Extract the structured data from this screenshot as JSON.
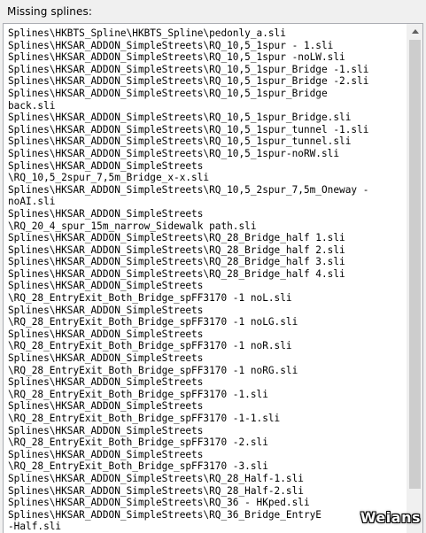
{
  "caption": "Missing splines:",
  "lines": [
    "Splines\\HKBTS_Spline\\HKBTS_Spline\\pedonly_a.sli",
    "Splines\\HKSAR_ADDON_SimpleStreets\\RQ_10,5_1spur - 1.sli",
    "Splines\\HKSAR_ADDON_SimpleStreets\\RQ_10,5_1spur -noLW.sli",
    "Splines\\HKSAR_ADDON_SimpleStreets\\RQ_10,5_1spur_Bridge -1.sli",
    "Splines\\HKSAR_ADDON_SimpleStreets\\RQ_10,5_1spur_Bridge -2.sli",
    "Splines\\HKSAR_ADDON_SimpleStreets\\RQ_10,5_1spur_Bridge",
    "back.sli",
    "Splines\\HKSAR_ADDON_SimpleStreets\\RQ_10,5_1spur_Bridge.sli",
    "Splines\\HKSAR_ADDON_SimpleStreets\\RQ_10,5_1spur_tunnel -1.sli",
    "Splines\\HKSAR_ADDON_SimpleStreets\\RQ_10,5_1spur_tunnel.sli",
    "Splines\\HKSAR_ADDON_SimpleStreets\\RQ_10,5_1spur-noRW.sli",
    "Splines\\HKSAR_ADDON_SimpleStreets",
    "\\RQ_10,5_2spur_7,5m_Bridge_x-x.sli",
    "Splines\\HKSAR_ADDON_SimpleStreets\\RQ_10,5_2spur_7,5m_Oneway -",
    "noAI.sli",
    "Splines\\HKSAR_ADDON_SimpleStreets",
    "\\RQ_20_4_spur_15m_narrow_Sidewalk path.sli",
    "Splines\\HKSAR_ADDON_SimpleStreets\\RQ_28_Bridge_half 1.sli",
    "Splines\\HKSAR_ADDON_SimpleStreets\\RQ_28_Bridge_half 2.sli",
    "Splines\\HKSAR_ADDON_SimpleStreets\\RQ_28_Bridge_half 3.sli",
    "Splines\\HKSAR_ADDON_SimpleStreets\\RQ_28_Bridge_half 4.sli",
    "Splines\\HKSAR_ADDON_SimpleStreets",
    "\\RQ_28_EntryExit_Both_Bridge_spFF3170 -1 noL.sli",
    "Splines\\HKSAR_ADDON_SimpleStreets",
    "\\RQ_28_EntryExit_Both_Bridge_spFF3170 -1 noLG.sli",
    "Splines\\HKSAR_ADDON_SimpleStreets",
    "\\RQ_28_EntryExit_Both_Bridge_spFF3170 -1 noR.sli",
    "Splines\\HKSAR_ADDON_SimpleStreets",
    "\\RQ_28_EntryExit_Both_Bridge_spFF3170 -1 noRG.sli",
    "Splines\\HKSAR_ADDON_SimpleStreets",
    "\\RQ_28_EntryExit_Both_Bridge_spFF3170 -1.sli",
    "Splines\\HKSAR_ADDON_SimpleStreets",
    "\\RQ_28_EntryExit_Both_Bridge_spFF3170 -1-1.sli",
    "Splines\\HKSAR_ADDON_SimpleStreets",
    "\\RQ_28_EntryExit_Both_Bridge_spFF3170 -2.sli",
    "Splines\\HKSAR_ADDON_SimpleStreets",
    "\\RQ_28_EntryExit_Both_Bridge_spFF3170 -3.sli",
    "Splines\\HKSAR_ADDON_SimpleStreets\\RQ_28_Half-1.sli",
    "Splines\\HKSAR_ADDON_SimpleStreets\\RQ_28_Half-2.sli",
    "Splines\\HKSAR_ADDON_SimpleStreets\\RQ_36 - HKped.sli",
    "Splines\\HKSAR_ADDON_SimpleStreets\\RQ_36_Bridge_EntryE",
    "-Half.sli"
  ],
  "watermark": "Weians",
  "icons": {
    "scroll_up": "arrow-up-icon"
  },
  "colors": {
    "window_bg": "#f0f0f0",
    "textbox_bg": "#ffffff",
    "textbox_border": "#abadb3",
    "scroll_thumb": "#cdcdcd"
  }
}
